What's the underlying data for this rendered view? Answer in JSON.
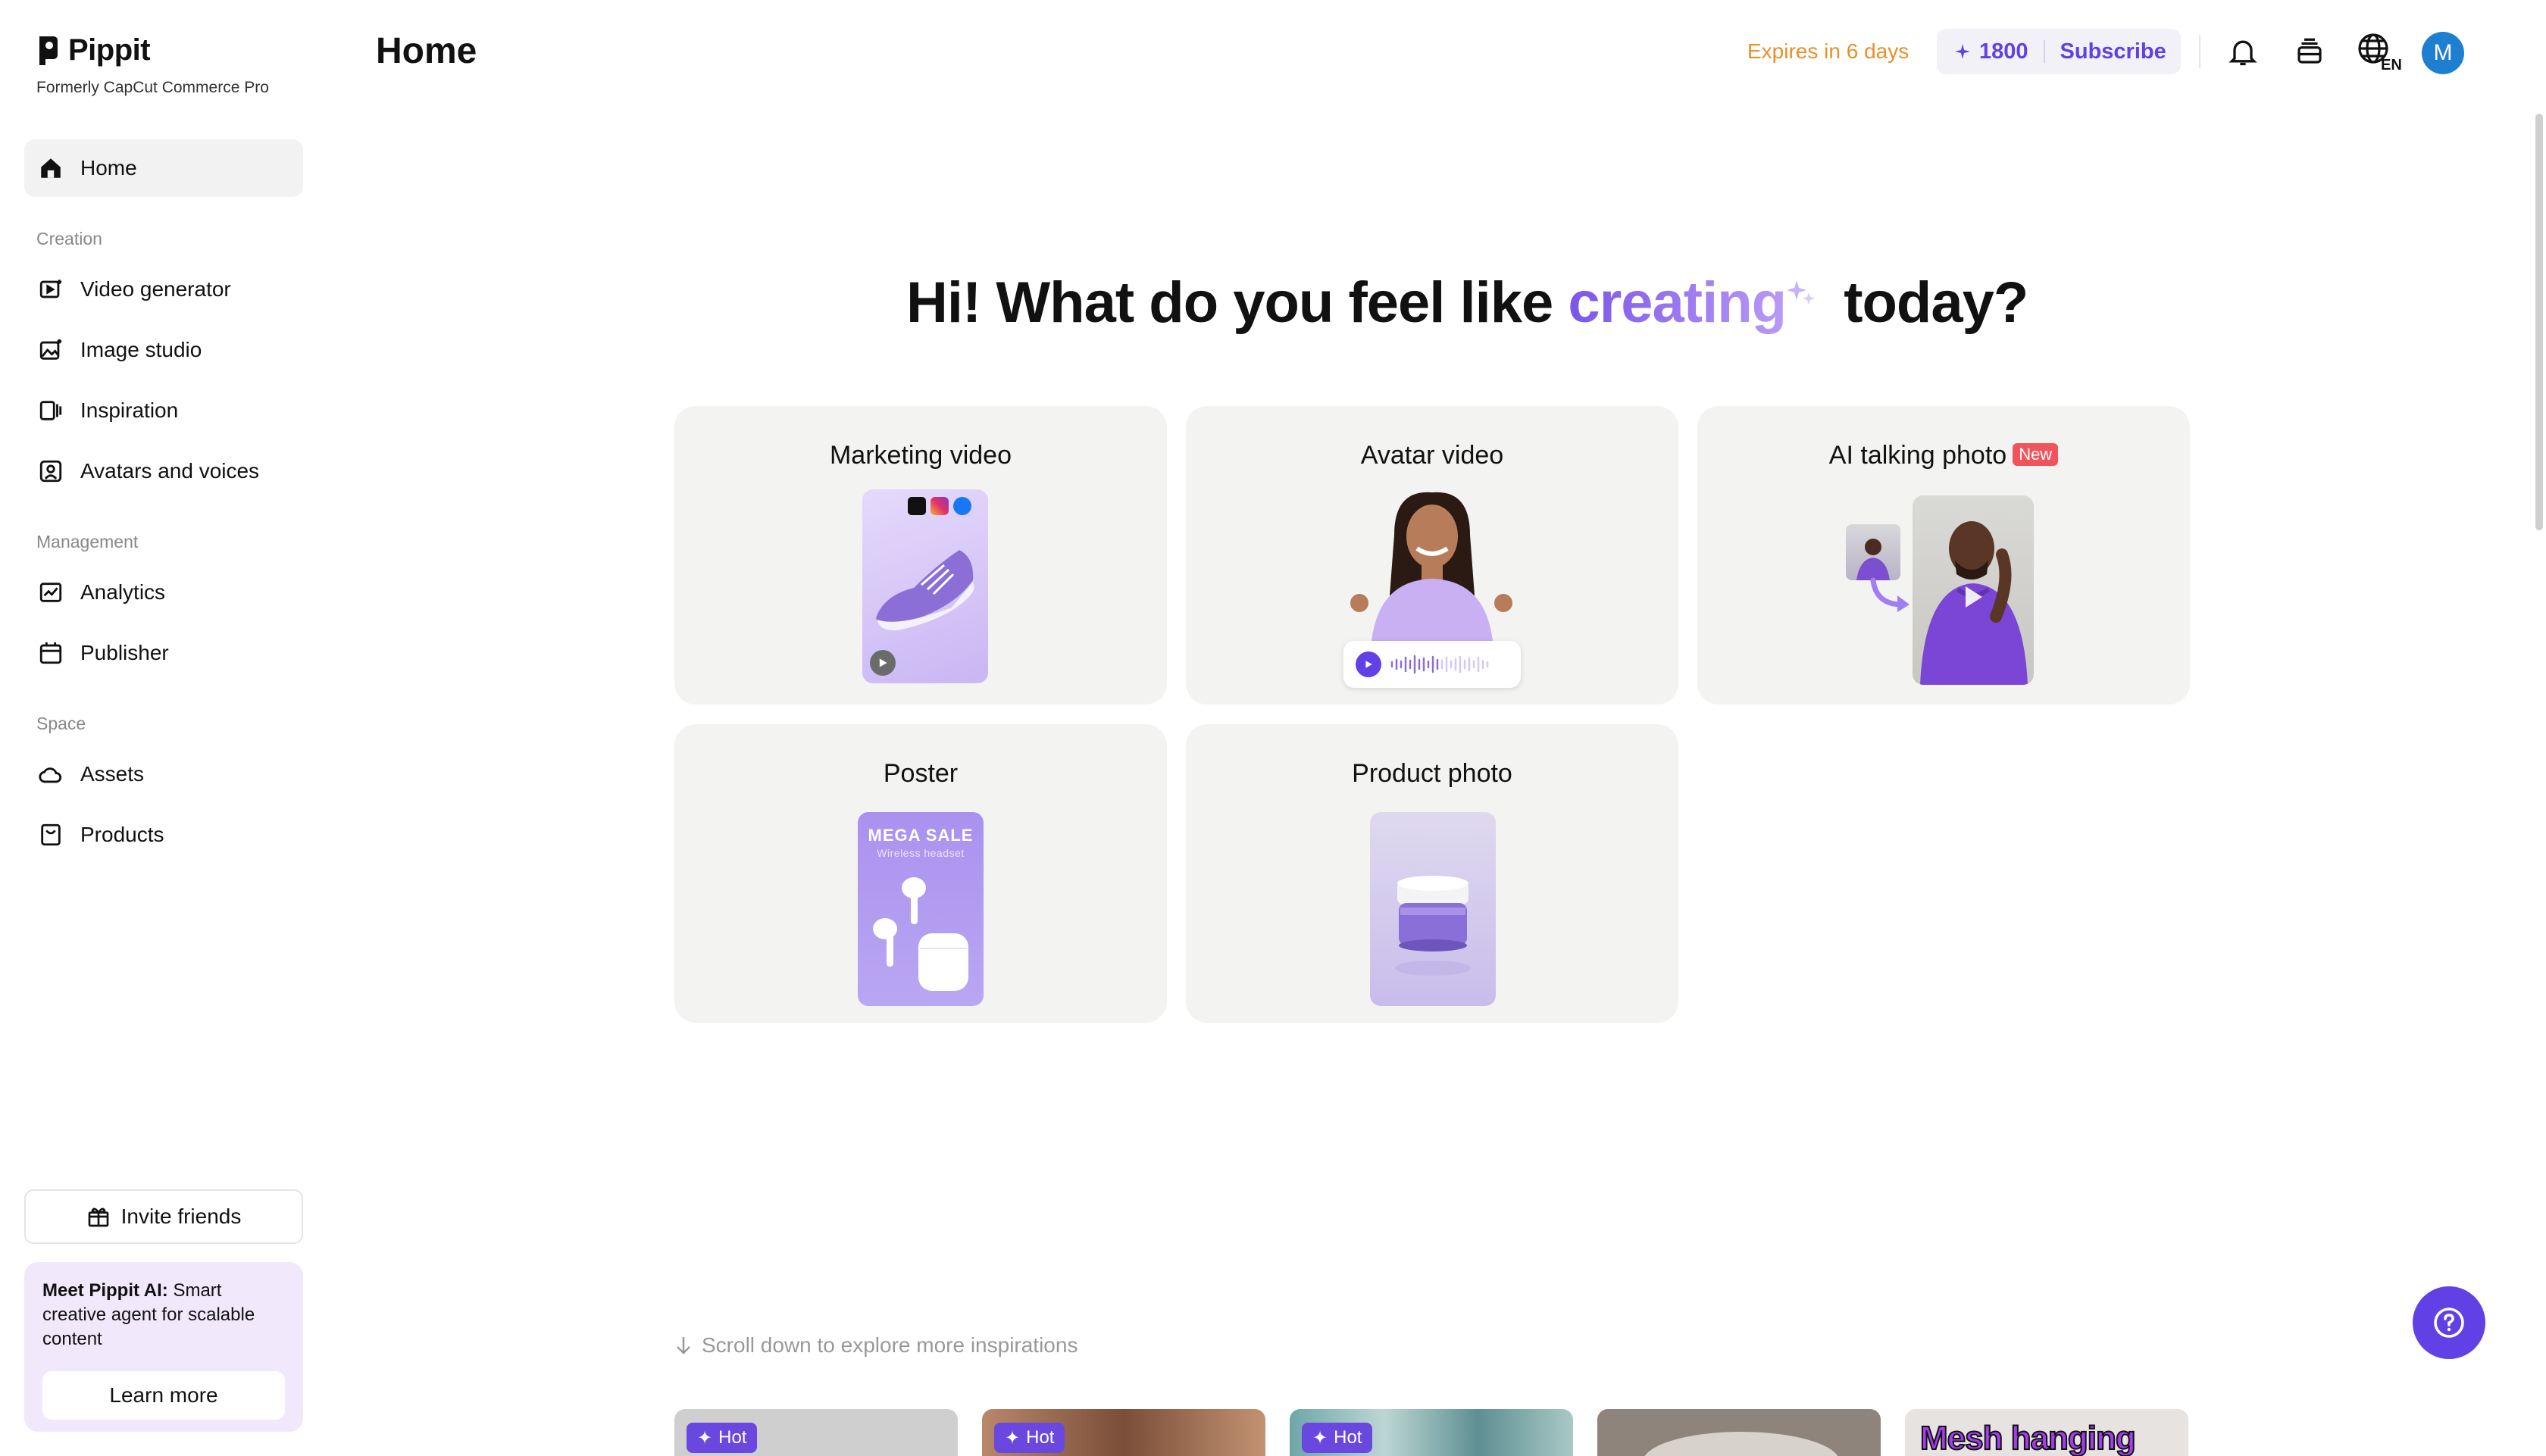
{
  "app": {
    "name": "Pippit",
    "subtitle": "Formerly CapCut Commerce Pro"
  },
  "sidebar": {
    "home": "Home",
    "sections": [
      {
        "label": "Creation",
        "items": [
          "Video generator",
          "Image studio",
          "Inspiration",
          "Avatars and voices"
        ]
      },
      {
        "label": "Management",
        "items": [
          "Analytics",
          "Publisher"
        ]
      },
      {
        "label": "Space",
        "items": [
          "Assets",
          "Products"
        ]
      }
    ],
    "invite": "Invite friends",
    "promo": {
      "bold": "Meet Pippit AI:",
      "text": " Smart creative agent for scalable content",
      "button": "Learn more"
    }
  },
  "header": {
    "title": "Home",
    "expires": "Expires in 6 days",
    "credits": "1800",
    "subscribe": "Subscribe",
    "language": "EN",
    "avatar_initial": "M"
  },
  "hero": {
    "prefix": "Hi! What do you feel like ",
    "accent": "creating",
    "suffix": " today?"
  },
  "cards": {
    "marketing": "Marketing video",
    "avatar": "Avatar video",
    "talking": "AI talking photo",
    "talking_badge": "New",
    "poster": "Poster",
    "poster_headline": "MEGA SALE",
    "poster_sub": "Wireless headset",
    "product": "Product photo"
  },
  "bottom": {
    "hint": "Scroll down to explore more inspirations",
    "hot_label": "Hot",
    "tile5_text": "Mesh hanging"
  },
  "colors": {
    "accent": "#6140e6",
    "expires": "#e8902a",
    "card_bg": "#f3f3f2"
  }
}
